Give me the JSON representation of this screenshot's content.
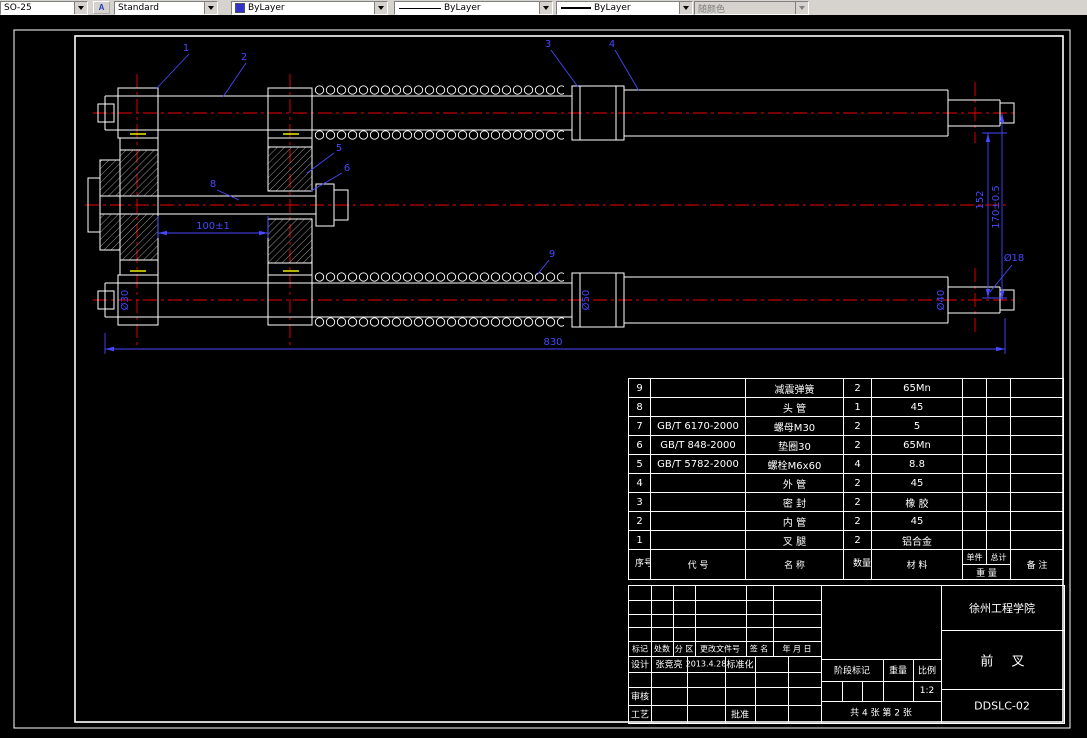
{
  "toolbar": {
    "dim_style_value": "SO-25",
    "style_button_glyph": "A",
    "text_style_value": "Standard",
    "color_value": "ByLayer",
    "linetype_value": "ByLayer",
    "lineweight_value": "ByLayer",
    "plot_style_value": "随颜色"
  },
  "colors": {
    "geometry": "#ffffff",
    "centerline": "#ee0000",
    "dimension": "#4747ff",
    "highlight": "#ffff00"
  },
  "drawing": {
    "callouts": [
      "1",
      "2",
      "3",
      "4",
      "5",
      "6",
      "8",
      "9"
    ],
    "dims": {
      "overall": "830",
      "axis_gap": "152",
      "leg_distance": "170±0.5",
      "stem": "100±1",
      "dia_inner": "Ø30",
      "dia_coupler": "Ø50",
      "dia_outer": "Ø40",
      "dia_tip": "Ø18"
    }
  },
  "bom": {
    "header": {
      "no": "序号",
      "code": "代 号",
      "name": "名 称",
      "qty": "数量",
      "material": "材 料",
      "unit": "单件",
      "total": "总计",
      "weight": "重 量",
      "remark": "备 注"
    },
    "rows": [
      {
        "no": "9",
        "code": "",
        "name": "减震弹簧",
        "qty": "2",
        "material": "65Mn"
      },
      {
        "no": "8",
        "code": "",
        "name": "头 管",
        "qty": "1",
        "material": "45"
      },
      {
        "no": "7",
        "code": "GB/T 6170-2000",
        "name": "螺母M30",
        "qty": "2",
        "material": "5"
      },
      {
        "no": "6",
        "code": "GB/T 848-2000",
        "name": "垫圈30",
        "qty": "2",
        "material": "65Mn"
      },
      {
        "no": "5",
        "code": "GB/T 5782-2000",
        "name": "螺栓M6x60",
        "qty": "4",
        "material": "8.8"
      },
      {
        "no": "4",
        "code": "",
        "name": "外 管",
        "qty": "2",
        "material": "45"
      },
      {
        "no": "3",
        "code": "",
        "name": "密 封",
        "qty": "2",
        "material": "橡 胶"
      },
      {
        "no": "2",
        "code": "",
        "name": "内 管",
        "qty": "2",
        "material": "45"
      },
      {
        "no": "1",
        "code": "",
        "name": "叉 腿",
        "qty": "2",
        "material": "铝合金"
      }
    ]
  },
  "titleblock": {
    "school": "徐州工程学院",
    "part_title": "前 叉",
    "drawing_number": "DDSLC-02",
    "designer": "张竞亮",
    "design_date": "2013.4.28",
    "scale_value": "1:2",
    "sheet_info": "共 4 张  第 2 张",
    "labels": {
      "mark": "标记",
      "count": "处数",
      "zone": "分 区",
      "change_doc": "更改文件号",
      "signature": "签 名",
      "date_lbl": "年 月 日",
      "design": "设计",
      "standardize": "标准化",
      "review": "审核",
      "process": "工艺",
      "approve": "批准",
      "stage_mark": "阶段标记",
      "weight": "重量",
      "scale": "比例"
    }
  }
}
